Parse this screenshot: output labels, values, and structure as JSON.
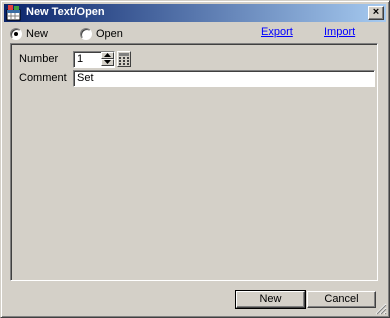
{
  "window": {
    "title": "New Text/Open",
    "close_label": "×"
  },
  "mode": {
    "new_label": "New",
    "open_label": "Open",
    "selected": "New"
  },
  "links": {
    "export_label": "Export",
    "import_label": "Import"
  },
  "form": {
    "number_label": "Number",
    "number_value": "1",
    "comment_label": "Comment",
    "comment_value": "Set"
  },
  "buttons": {
    "new_label": "New",
    "cancel_label": "Cancel"
  },
  "colors": {
    "titlebar_start": "#0a246a",
    "titlebar_end": "#a6caf0",
    "face": "#d4d0c8",
    "link": "#0000ff"
  },
  "icons": {
    "app": "text-table-icon",
    "close": "close-icon",
    "spin_up": "arrow-up-icon",
    "spin_down": "arrow-down-icon",
    "keypad": "keypad-icon",
    "grip": "resize-grip-icon"
  }
}
